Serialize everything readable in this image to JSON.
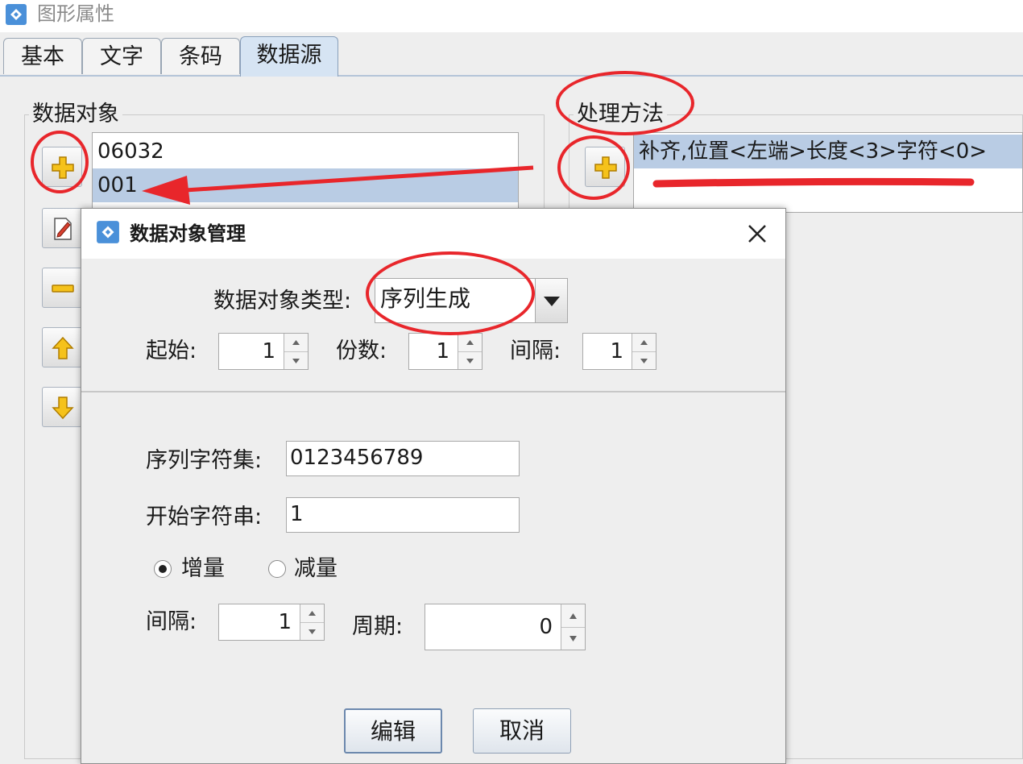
{
  "window": {
    "title": "图形属性"
  },
  "tabs": [
    {
      "label": "基本"
    },
    {
      "label": "文字"
    },
    {
      "label": "条码"
    },
    {
      "label": "数据源",
      "active": true
    }
  ],
  "data_objects": {
    "title": "数据对象",
    "items": [
      "06032",
      "001"
    ],
    "selected": "001"
  },
  "processing": {
    "title": "处理方法",
    "items": [
      "补齐,位置<左端>长度<3>字符<0>"
    ]
  },
  "dialog": {
    "title": "数据对象管理",
    "type_label": "数据对象类型:",
    "type_value": "序列生成",
    "start_label": "起始:",
    "start_value": "1",
    "copies_label": "份数:",
    "copies_value": "1",
    "interval_label": "间隔:",
    "interval_value": "1",
    "charset_label": "序列字符集:",
    "charset_value": "0123456789",
    "start_string_label": "开始字符串:",
    "start_string_value": "1",
    "increment_label": "增量",
    "decrement_label": "减量",
    "increment_selected": true,
    "step_label": "间隔:",
    "step_value": "1",
    "period_label": "周期:",
    "period_value": "0",
    "edit_button": "编辑",
    "cancel_button": "取消"
  },
  "colors": {
    "annotation": "#e8262b",
    "selection": "#b9cce4",
    "active_tab": "#d6e4f3"
  }
}
